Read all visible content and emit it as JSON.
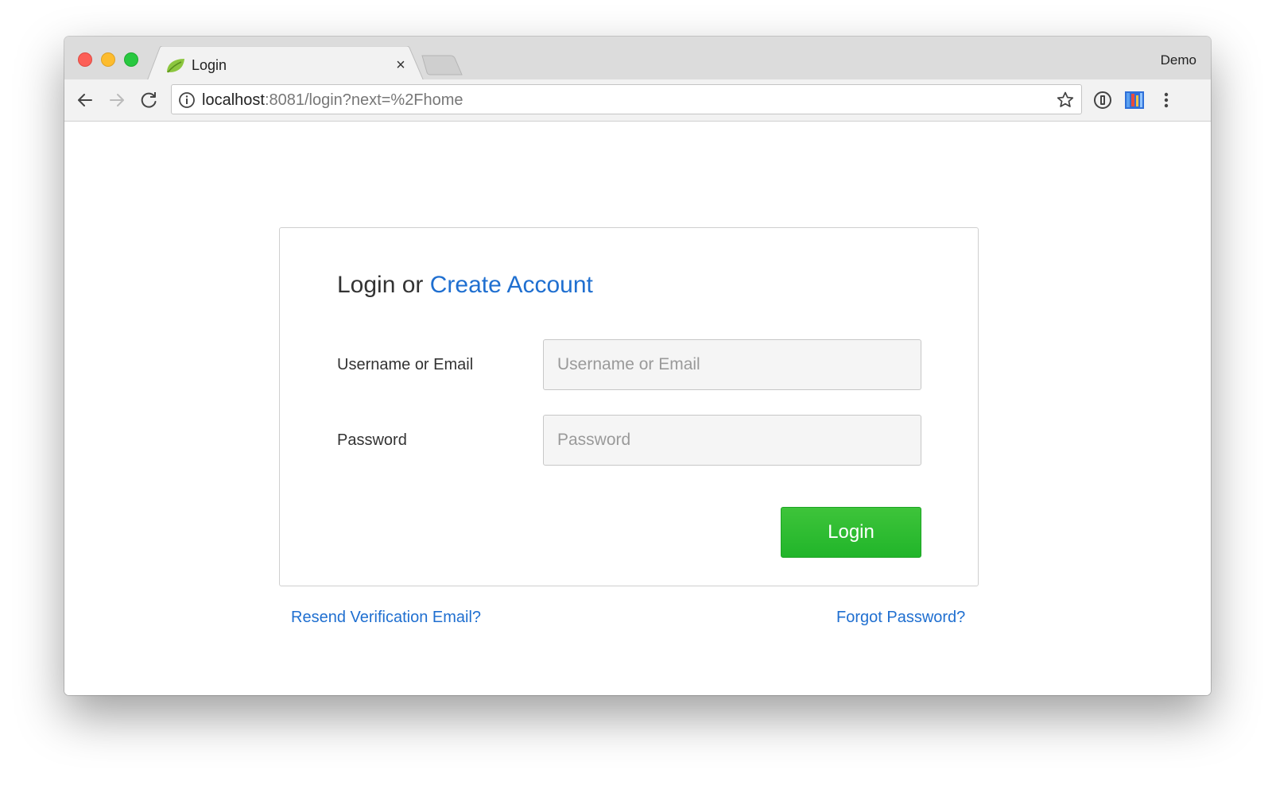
{
  "browser": {
    "tab_title": "Login",
    "tab_close": "×",
    "profile_name": "Demo",
    "url_host": "localhost",
    "url_rest": ":8081/login?next=%2Fhome"
  },
  "page": {
    "heading_prefix": "Login or ",
    "heading_link": "Create Account",
    "username_label": "Username or Email",
    "username_placeholder": "Username or Email",
    "password_label": "Password",
    "password_placeholder": "Password",
    "login_button": "Login",
    "resend_link": "Resend Verification Email?",
    "forgot_link": "Forgot Password?"
  },
  "colors": {
    "accent_link": "#1f6fd0",
    "login_button": "#2bbb2f"
  },
  "icons": {
    "traffic_lights": [
      "close",
      "minimize",
      "zoom"
    ],
    "tab_favicon": "leaf-icon",
    "toolbar": [
      "back-arrow-icon",
      "forward-arrow-icon",
      "reload-icon",
      "info-icon",
      "star-icon",
      "password-manager-icon",
      "extension-icon",
      "menu-icon"
    ]
  }
}
